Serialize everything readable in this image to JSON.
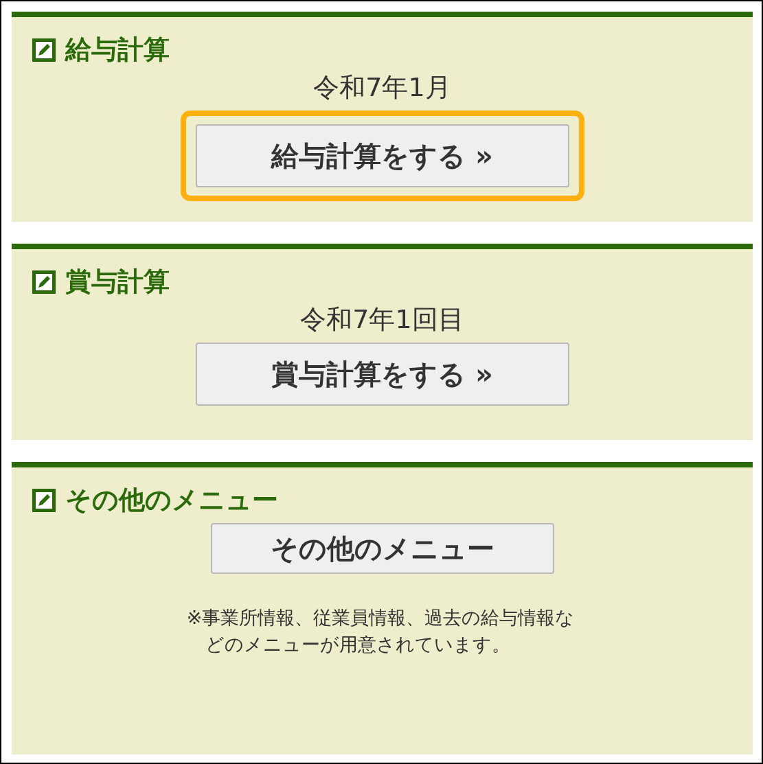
{
  "sections": [
    {
      "title": "給与計算",
      "period": "令和7年1月",
      "button": {
        "label": "給与計算をする »",
        "highlighted": true
      }
    },
    {
      "title": "賞与計算",
      "period": "令和7年1回目",
      "button": {
        "label": "賞与計算をする »",
        "highlighted": false
      }
    },
    {
      "title": "その他のメニュー",
      "button": {
        "label": "その他のメニュー",
        "highlighted": false
      },
      "note": "※事業所情報、従業員情報、過去の給与情報などのメニューが用意されています。"
    }
  ]
}
